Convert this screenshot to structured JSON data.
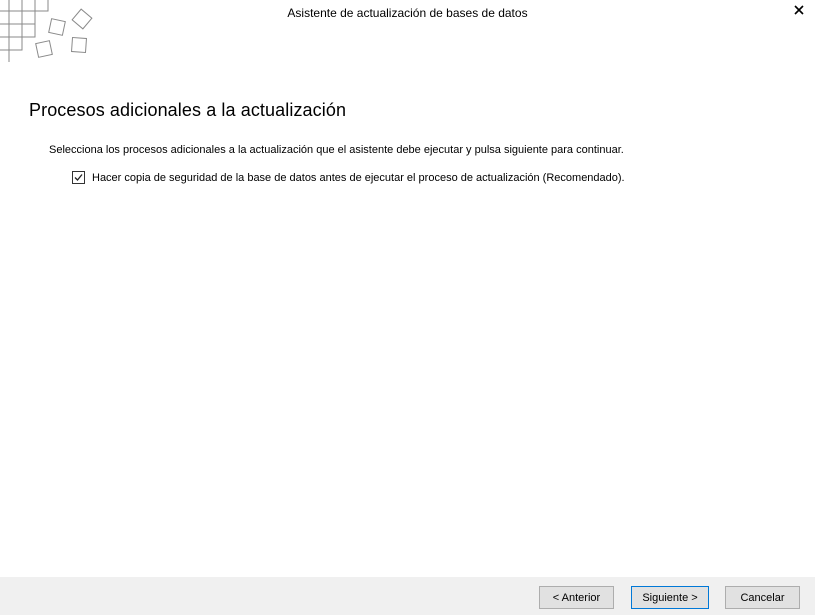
{
  "window": {
    "title": "Asistente de actualización de bases de datos",
    "close_glyph": "✕"
  },
  "page": {
    "heading": "Procesos adicionales a la actualización",
    "instructions": "Selecciona los procesos adicionales a la actualización que el asistente debe ejecutar y pulsa siguiente para continuar.",
    "options": [
      {
        "label": "Hacer copia de seguridad de la base de datos antes de ejecutar el proceso de actualización (Recomendado).",
        "checked": true
      }
    ]
  },
  "footer": {
    "back_label": "< Anterior",
    "next_label": "Siguiente >",
    "cancel_label": "Cancelar"
  },
  "icons": {
    "logo": "tiles-logo-icon",
    "close": "close-icon",
    "check": "checkmark-icon"
  },
  "colors": {
    "footer_bg": "#f0f0f0",
    "button_bg": "#e1e1e1",
    "default_button_border": "#0078d7"
  }
}
